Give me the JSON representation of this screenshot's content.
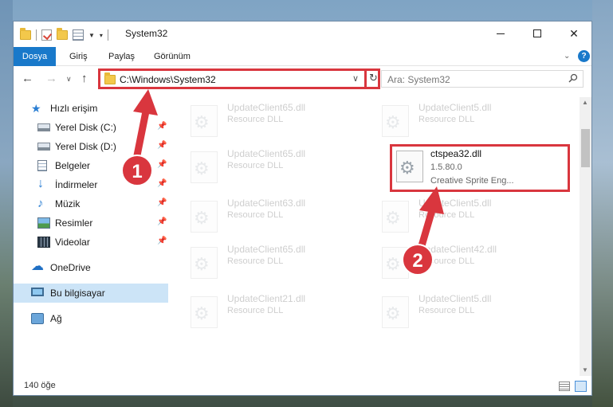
{
  "window": {
    "title": "System32",
    "minimize_glyph": "—",
    "close_glyph": "✕"
  },
  "ribbon": {
    "tabs": [
      "Dosya",
      "Giriş",
      "Paylaş",
      "Görünüm"
    ],
    "help_glyph": "?"
  },
  "navigation": {
    "address_path": "C:\\Windows\\System32",
    "search_placeholder": "Ara: System32"
  },
  "sidebar": {
    "quick_access": "Hızlı erişim",
    "items": [
      {
        "label": "Yerel Disk (C:)",
        "icon": "drive-icon",
        "pinned": true
      },
      {
        "label": "Yerel Disk (D:)",
        "icon": "drive-icon",
        "pinned": true
      },
      {
        "label": "Belgeler",
        "icon": "documents-icon",
        "pinned": true
      },
      {
        "label": "İndirmeler",
        "icon": "download-icon",
        "pinned": true
      },
      {
        "label": "Müzik",
        "icon": "music-icon",
        "pinned": true
      },
      {
        "label": "Resimler",
        "icon": "pictures-icon",
        "pinned": true
      },
      {
        "label": "Videolar",
        "icon": "videos-icon",
        "pinned": true
      }
    ],
    "onedrive": "OneDrive",
    "this_pc": "Bu bilgisayar",
    "network": "Ağ"
  },
  "files": [
    {
      "name": "UpdateClient65.dll",
      "subtitle": "Resource DLL"
    },
    {
      "name": "UpdateClient5.dll",
      "subtitle": "Resource DLL"
    },
    {
      "name": "UpdateClient65.dll",
      "subtitle": "Resource DLL"
    },
    {
      "name": "ctspea32.dll",
      "version": "1.5.80.0",
      "description": "Creative Sprite Eng..."
    },
    {
      "name": "UpdateClient63.dll",
      "subtitle": "Resource DLL"
    },
    {
      "name": "UpdateClient5.dll",
      "subtitle": "Resource DLL"
    },
    {
      "name": "UpdateClient65.dll",
      "subtitle": "Resource DLL"
    },
    {
      "name": "UpdateClient42.dll",
      "subtitle": "Resource DLL"
    },
    {
      "name": "UpdateClient21.dll",
      "subtitle": "Resource DLL"
    },
    {
      "name": "UpdateClient5.dll",
      "subtitle": "Resource DLL"
    }
  ],
  "status": {
    "item_count": "140 öğe"
  },
  "annotations": {
    "step1": "1",
    "step2": "2",
    "highlight_color": "#d9363e"
  }
}
